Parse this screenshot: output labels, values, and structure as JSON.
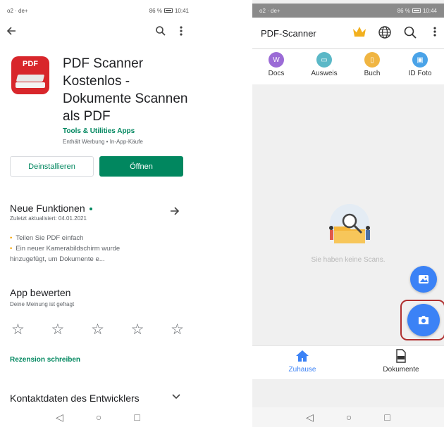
{
  "left": {
    "status": {
      "carrier": "o2 · de+",
      "battery": "86 %",
      "time": "10:41"
    },
    "app": {
      "icon_badge": "PDF",
      "title": "PDF Scanner Kostenlos - Dokumente Scannen als PDF",
      "developer": "Tools & Utilities Apps",
      "tags": "Enthält Werbung • In-App-Käufe"
    },
    "buttons": {
      "uninstall": "Deinstallieren",
      "open": "Öffnen"
    },
    "whats_new": {
      "title": "Neue Funktionen",
      "updated": "Zuletzt aktualisiert: 04.01.2021",
      "line1": "Teilen Sie PDF einfach",
      "line2": "Ein neuer Kamerabildschirm wurde hinzugefügt, um Dokumente e..."
    },
    "rate": {
      "title": "App bewerten",
      "subtitle": "Deine Meinung ist gefragt"
    },
    "review_link": "Rezension schreiben",
    "contact_title": "Kontaktdaten des Entwicklers"
  },
  "right": {
    "status": {
      "carrier": "o2 · de+",
      "battery": "86 %",
      "time": "10:44"
    },
    "header": {
      "title": "PDF-Scanner"
    },
    "categories": [
      {
        "label": "Docs",
        "color": "#9b6bd6",
        "glyph": "W"
      },
      {
        "label": "Ausweis",
        "color": "#5bb8c7",
        "glyph": "▭"
      },
      {
        "label": "Buch",
        "color": "#f0b542",
        "glyph": "▯"
      },
      {
        "label": "ID Foto",
        "color": "#4aa3e8",
        "glyph": "▣"
      }
    ],
    "empty_text": "Sie haben keine Scans.",
    "tabs": {
      "home": "Zuhause",
      "docs": "Dokumente"
    }
  },
  "colors": {
    "play_green": "#01875f",
    "accent_blue": "#3b82f6",
    "highlight": "#b03030"
  },
  "icons": [
    "back-arrow-icon",
    "search-icon",
    "more-vert-icon",
    "arrow-right-icon",
    "star-icon",
    "chevron-down-icon",
    "crown-icon",
    "globe-icon",
    "gallery-icon",
    "camera-icon",
    "home-icon",
    "pdf-document-icon"
  ]
}
